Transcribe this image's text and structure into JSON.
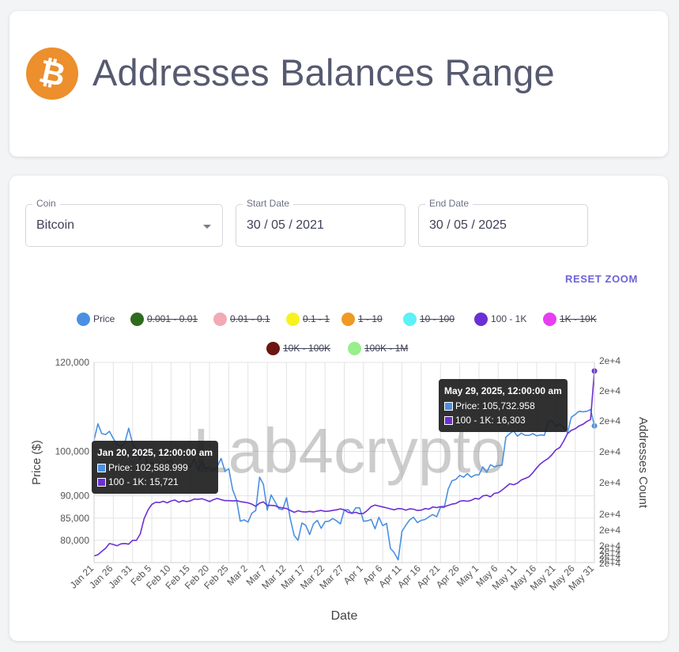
{
  "header": {
    "title": "Addresses Balances Range",
    "logo_glyph": "₿",
    "logo_color": "#ec8f2c"
  },
  "filters": {
    "coin": {
      "label": "Coin",
      "value": "Bitcoin"
    },
    "start_date": {
      "label": "Start Date",
      "value": "30 / 05 / 2021"
    },
    "end_date": {
      "label": "End Date",
      "value": "30 / 05 / 2025"
    }
  },
  "reset_zoom_label": "RESET ZOOM",
  "legend": [
    {
      "label": "Price",
      "color": "#4a90e2",
      "hidden": false
    },
    {
      "label": "0.001 - 0.01",
      "color": "#2e6b1f",
      "hidden": true
    },
    {
      "label": "0.01 - 0.1",
      "color": "#f2aab4",
      "hidden": true
    },
    {
      "label": "0.1 - 1",
      "color": "#f7f21f",
      "hidden": true
    },
    {
      "label": "1 - 10",
      "color": "#ef9a22",
      "hidden": true
    },
    {
      "label": "10 - 100",
      "color": "#5ef0f7",
      "hidden": true
    },
    {
      "label": "100 - 1K",
      "color": "#6c2fd4",
      "hidden": false
    },
    {
      "label": "1K - 10K",
      "color": "#e63ef0",
      "hidden": true
    },
    {
      "label": "10K - 100K",
      "color": "#6b1610",
      "hidden": true
    },
    {
      "label": "100K - 1M",
      "color": "#98ee8c",
      "hidden": true
    }
  ],
  "tooltips": [
    {
      "title": "Jan 20, 2025, 12:00:00 am",
      "price": "Price: 102,588.999",
      "series": "100 - 1K: 15,721"
    },
    {
      "title": "May 29, 2025, 12:00:00 am",
      "price": "Price: 105,732.958",
      "series": "100 - 1K: 16,303"
    }
  ],
  "chart_data": {
    "type": "line",
    "title": "",
    "watermark": "Lab4crypto",
    "xlabel": "Date",
    "ylabel": "Price ($)",
    "y2label": "Addresses Count",
    "xticks": [
      "Jan 21",
      "Jan 26",
      "Jan 31",
      "Feb 5",
      "Feb 10",
      "Feb 15",
      "Feb 20",
      "Feb 25",
      "Mar 2",
      "Mar 7",
      "Mar 12",
      "Mar 17",
      "Mar 22",
      "Mar 27",
      "Apr 1",
      "Apr 6",
      "Apr 11",
      "Apr 16",
      "Apr 21",
      "Apr 26",
      "May 1",
      "May 6",
      "May 11",
      "May 16",
      "May 21",
      "May 26",
      "May 31"
    ],
    "yticks": [
      80000,
      85000,
      90000,
      100000,
      120000
    ],
    "ytick_labels": [
      "80,000",
      "85,000",
      "90,000",
      "100,000",
      "120,000"
    ],
    "ylim": [
      75000,
      120000
    ],
    "y2ticks": [
      "2e+4",
      "2e+4",
      "2e+4",
      "2e+4",
      "2e+4",
      "2e+4",
      "2e+4",
      "2e+4",
      "2e+4",
      "2e+4",
      "2e+4",
      "2e+4",
      "2e+4"
    ],
    "grid": true,
    "x_day_range": [
      0,
      130
    ],
    "series": [
      {
        "name": "Price",
        "axis": "left",
        "color": "#4a90e2",
        "x": [
          0,
          1,
          2,
          3,
          4,
          5,
          6,
          7,
          8,
          9,
          10,
          11,
          12,
          13,
          14,
          15,
          16,
          17,
          18,
          19,
          20,
          21,
          22,
          23,
          24,
          25,
          26,
          27,
          28,
          29,
          30,
          31,
          32,
          33,
          34,
          35,
          36,
          37,
          38,
          39,
          40,
          41,
          42,
          43,
          44,
          45,
          46,
          47,
          48,
          49,
          50,
          51,
          52,
          53,
          54,
          55,
          56,
          57,
          58,
          59,
          60,
          61,
          62,
          63,
          64,
          65,
          66,
          67,
          68,
          69,
          70,
          71,
          72,
          73,
          74,
          75,
          76,
          77,
          78,
          79,
          80,
          81,
          82,
          83,
          84,
          85,
          86,
          87,
          88,
          89,
          90,
          91,
          92,
          93,
          94,
          95,
          96,
          97,
          98,
          99,
          100,
          101,
          102,
          103,
          104,
          105,
          106,
          107,
          108,
          109,
          110,
          111,
          112,
          113,
          114,
          115,
          116,
          117,
          118,
          119,
          120,
          121,
          122,
          123,
          124,
          125,
          126,
          127,
          128,
          129,
          130
        ],
        "values": [
          102589,
          106200,
          104000,
          103800,
          104500,
          102900,
          101500,
          101000,
          102000,
          105200,
          101800,
          100300,
          98200,
          100600,
          96500,
          97500,
          96700,
          97100,
          96000,
          97700,
          97900,
          96500,
          95600,
          96100,
          97000,
          96400,
          98300,
          95900,
          97700,
          96200,
          96400,
          95700,
          96600,
          98400,
          95500,
          96100,
          91400,
          89100,
          84300,
          84600,
          84100,
          86100,
          86700,
          94200,
          92600,
          86800,
          90200,
          88700,
          87100,
          86900,
          89600,
          84800,
          81100,
          80000,
          83900,
          83400,
          81300,
          83700,
          84500,
          82700,
          84200,
          84300,
          84900,
          84400,
          83700,
          86800,
          86900,
          86000,
          87300,
          87300,
          84300,
          84400,
          84700,
          82600,
          85200,
          83300,
          83800,
          78200,
          77200,
          75600,
          82000,
          83400,
          84600,
          85200,
          84000,
          84500,
          84700,
          85300,
          85800,
          85300,
          87400,
          87400,
          91500,
          93400,
          93700,
          94600,
          94200,
          95000,
          94200,
          94700,
          94700,
          96500,
          95300,
          97000,
          96500,
          96800,
          96900,
          103200,
          104000,
          104600,
          103400,
          104100,
          103600,
          103600,
          104000,
          103500,
          103700,
          103600,
          106700,
          106900,
          105600,
          106200,
          105400,
          104200,
          107700,
          108300,
          109000,
          108900,
          109000,
          109400,
          105733
        ]
      },
      {
        "name": "100 - 1K",
        "axis": "right",
        "color": "#6c2fd4",
        "x": [
          0,
          1,
          2,
          3,
          4,
          5,
          6,
          7,
          8,
          9,
          10,
          11,
          12,
          13,
          14,
          15,
          16,
          17,
          18,
          19,
          20,
          21,
          22,
          23,
          24,
          25,
          26,
          27,
          28,
          29,
          30,
          31,
          32,
          33,
          34,
          35,
          36,
          37,
          38,
          39,
          40,
          41,
          42,
          43,
          44,
          45,
          46,
          47,
          48,
          49,
          50,
          51,
          52,
          53,
          54,
          55,
          56,
          57,
          58,
          59,
          60,
          61,
          62,
          63,
          64,
          65,
          66,
          67,
          68,
          69,
          70,
          71,
          72,
          73,
          74,
          75,
          76,
          77,
          78,
          79,
          80,
          81,
          82,
          83,
          84,
          85,
          86,
          87,
          88,
          89,
          90,
          91,
          92,
          93,
          94,
          95,
          96,
          97,
          98,
          99,
          100,
          101,
          102,
          103,
          104,
          105,
          106,
          107,
          108,
          109,
          110,
          111,
          112,
          113,
          114,
          115,
          116,
          117,
          118,
          119,
          120,
          121,
          122,
          123,
          124,
          125,
          126,
          127,
          128,
          129,
          130
        ],
        "values": [
          15721,
          15725,
          15735,
          15745,
          15760,
          15757,
          15753,
          15759,
          15760,
          15758,
          15770,
          15770,
          15790,
          15838,
          15865,
          15883,
          15890,
          15889,
          15893,
          15888,
          15894,
          15897,
          15890,
          15895,
          15892,
          15894,
          15900,
          15899,
          15901,
          15897,
          15892,
          15898,
          15902,
          15898,
          15895,
          15895,
          15894,
          15895,
          15892,
          15890,
          15888,
          15884,
          15877,
          15887,
          15891,
          15880,
          15880,
          15879,
          15874,
          15872,
          15870,
          15864,
          15858,
          15863,
          15860,
          15859,
          15861,
          15859,
          15862,
          15864,
          15861,
          15862,
          15864,
          15866,
          15869,
          15866,
          15858,
          15856,
          15858,
          15854,
          15855,
          15864,
          15876,
          15881,
          15878,
          15875,
          15872,
          15869,
          15866,
          15870,
          15869,
          15865,
          15869,
          15868,
          15864,
          15865,
          15870,
          15868,
          15875,
          15873,
          15876,
          15876,
          15880,
          15884,
          15886,
          15893,
          15895,
          15893,
          15896,
          15902,
          15900,
          15910,
          15912,
          15907,
          15918,
          15920,
          15928,
          15938,
          15948,
          15945,
          15950,
          15960,
          15965,
          15970,
          15983,
          15998,
          16011,
          16020,
          16028,
          16040,
          16055,
          16062,
          16082,
          16106,
          16116,
          16121,
          16130,
          16135,
          16144,
          16150,
          16303
        ]
      }
    ]
  }
}
